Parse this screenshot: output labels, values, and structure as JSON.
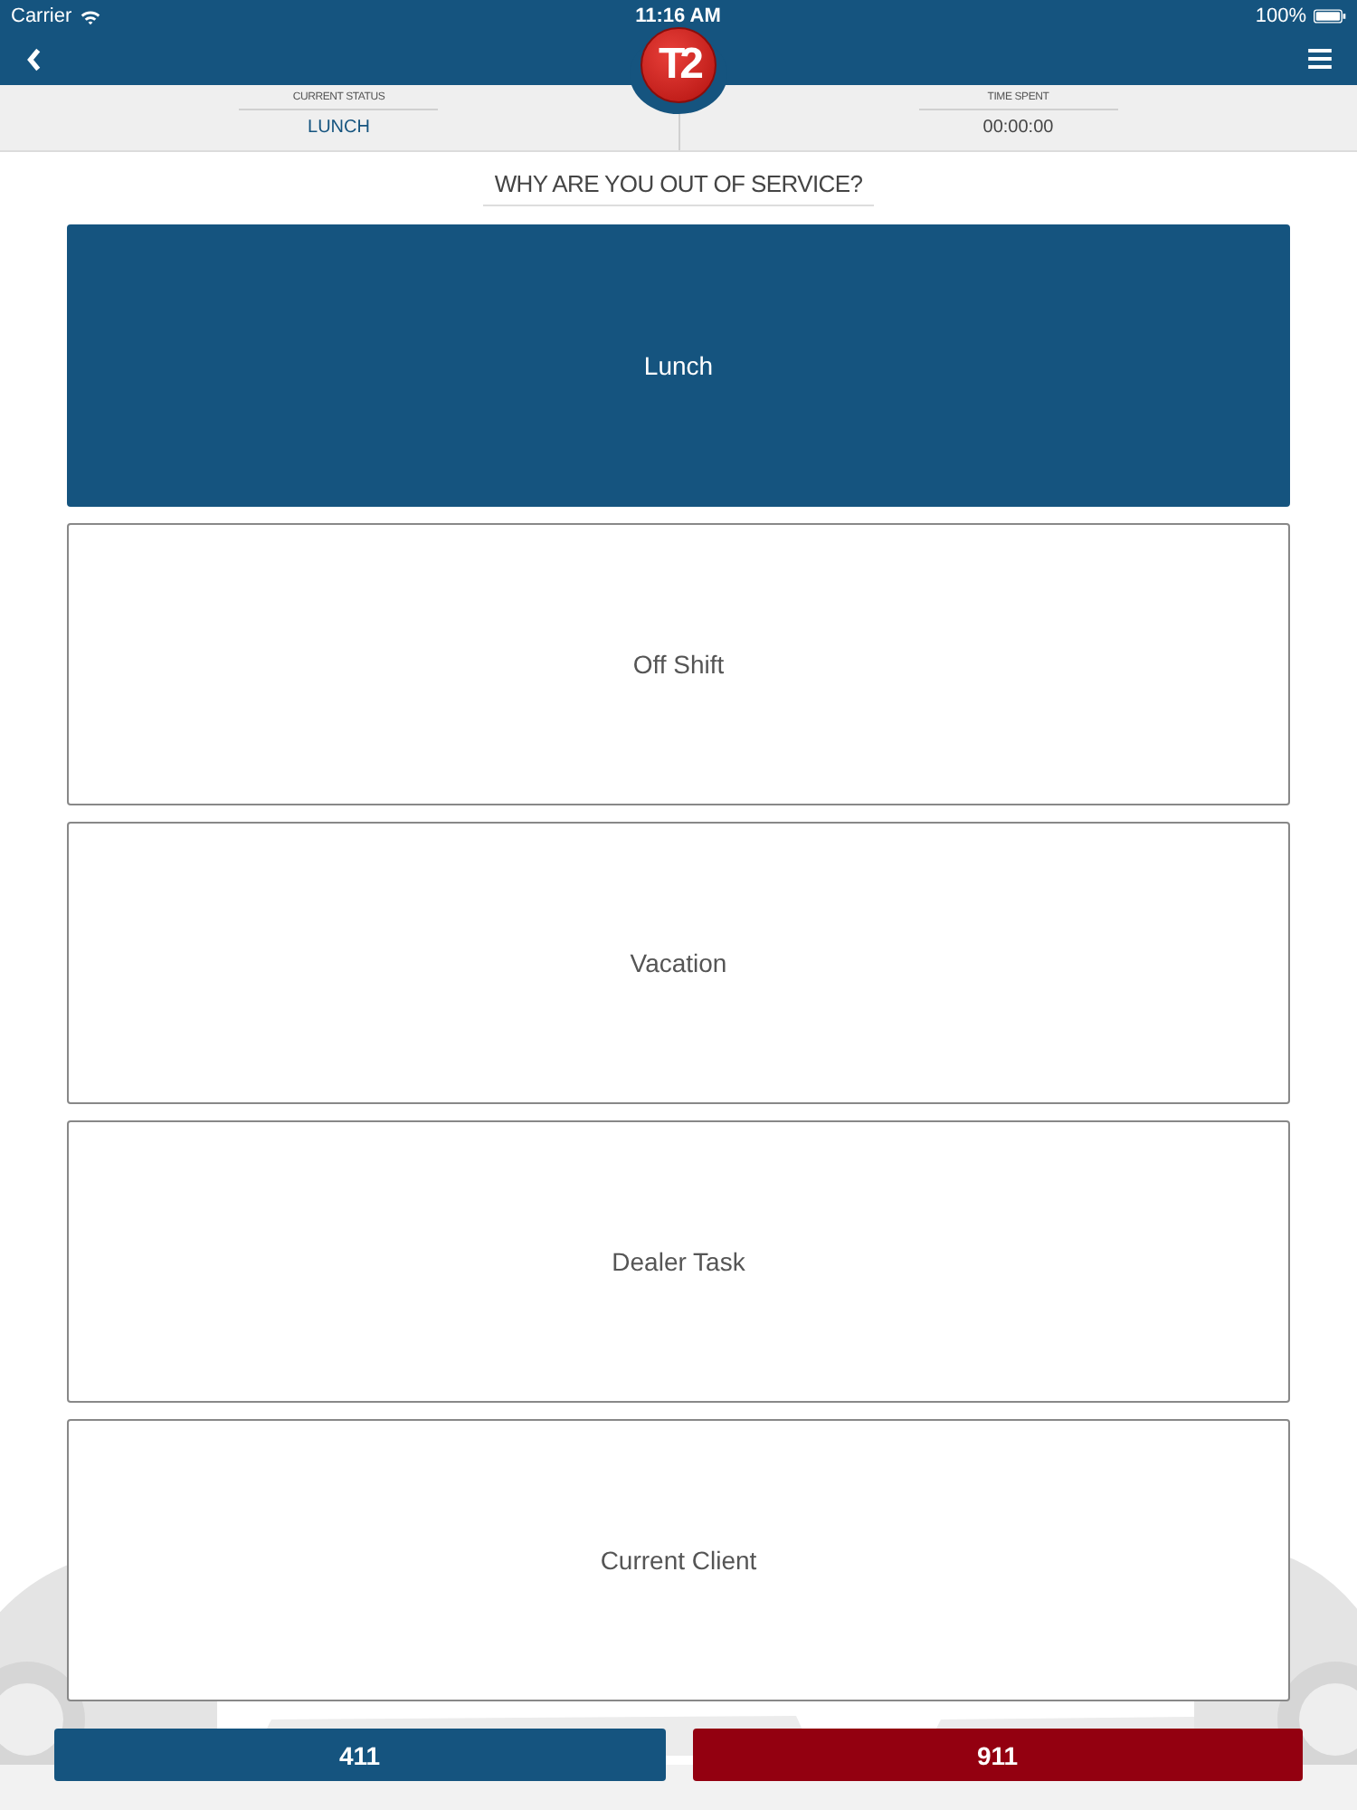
{
  "status_bar": {
    "carrier": "Carrier",
    "time": "11:16 AM",
    "battery": "100%"
  },
  "logo": {
    "text": "T2"
  },
  "info": [
    {
      "label": "CURRENT STATUS",
      "value": "LUNCH",
      "kind": "status"
    },
    {
      "label": "TIME SPENT",
      "value": "00:00:00",
      "kind": "time"
    }
  ],
  "heading": "WHY ARE YOU OUT OF SERVICE?",
  "options": [
    {
      "label": "Lunch",
      "selected": true
    },
    {
      "label": "Off Shift",
      "selected": false
    },
    {
      "label": "Vacation",
      "selected": false
    },
    {
      "label": "Dealer Task",
      "selected": false
    },
    {
      "label": "Current Client",
      "selected": false
    }
  ],
  "buttons": [
    {
      "label": "411",
      "kind": "info"
    },
    {
      "label": "911",
      "kind": "emergency"
    }
  ]
}
